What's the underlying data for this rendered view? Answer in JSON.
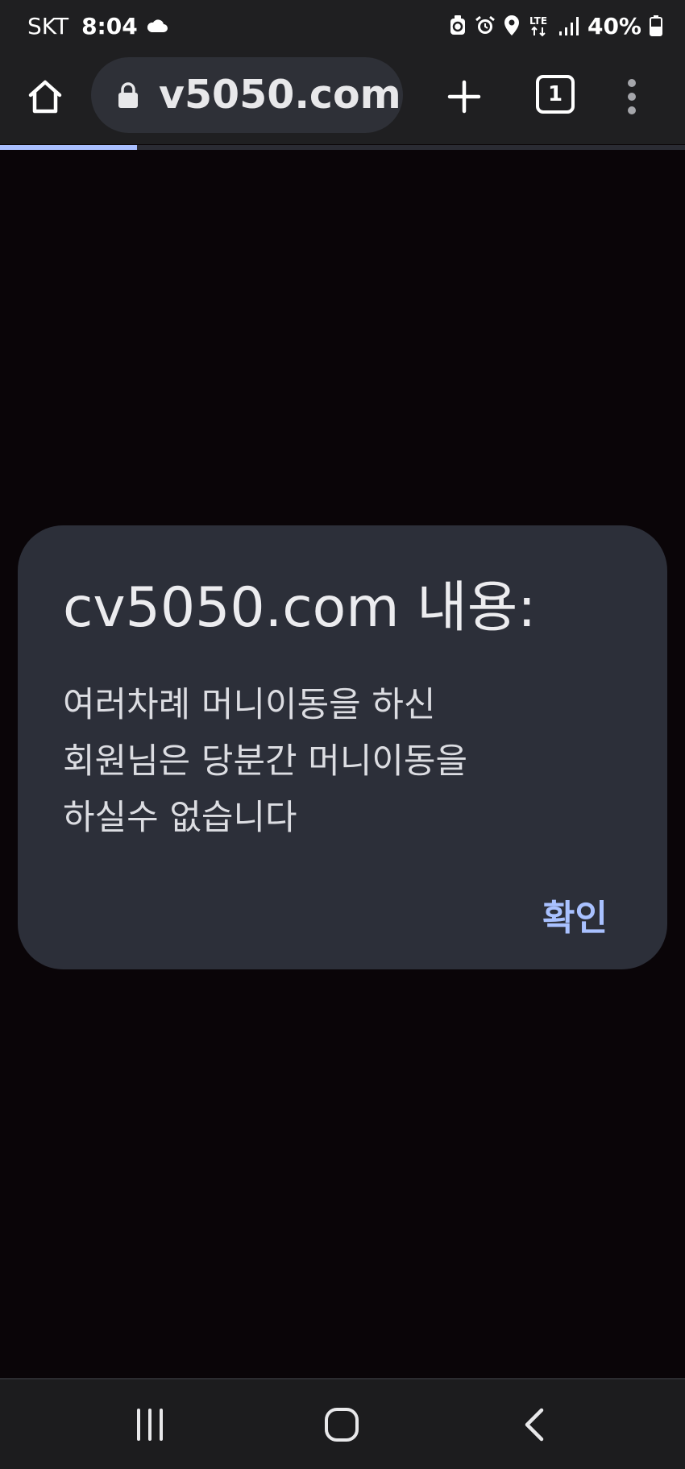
{
  "status_bar": {
    "carrier": "SKT",
    "time": "8:04",
    "network": "LTE",
    "battery_percent": "40%",
    "icons": [
      "cloud-icon",
      "recycle-icon",
      "alarm-icon",
      "location-icon",
      "lte-icon",
      "signal-icon",
      "battery-icon"
    ]
  },
  "browser": {
    "url": "v5050.com",
    "tab_count": "1",
    "load_progress": 0.2,
    "accent_color": "#a9bfff",
    "icons": [
      "home-icon",
      "lock-icon",
      "plus-icon",
      "tabs-icon",
      "more-vert-icon"
    ]
  },
  "dialog": {
    "title": "cv5050.com 내용:",
    "message_lines": [
      "여러차례 머니이동을 하신",
      "회원님은 당분간 머니이동을",
      "하실수 없습니다"
    ],
    "confirm_label": "확인",
    "accent_color": "#a9c1ff"
  },
  "nav_bar": {
    "icons": [
      "recents-icon",
      "home-icon",
      "back-icon"
    ]
  }
}
